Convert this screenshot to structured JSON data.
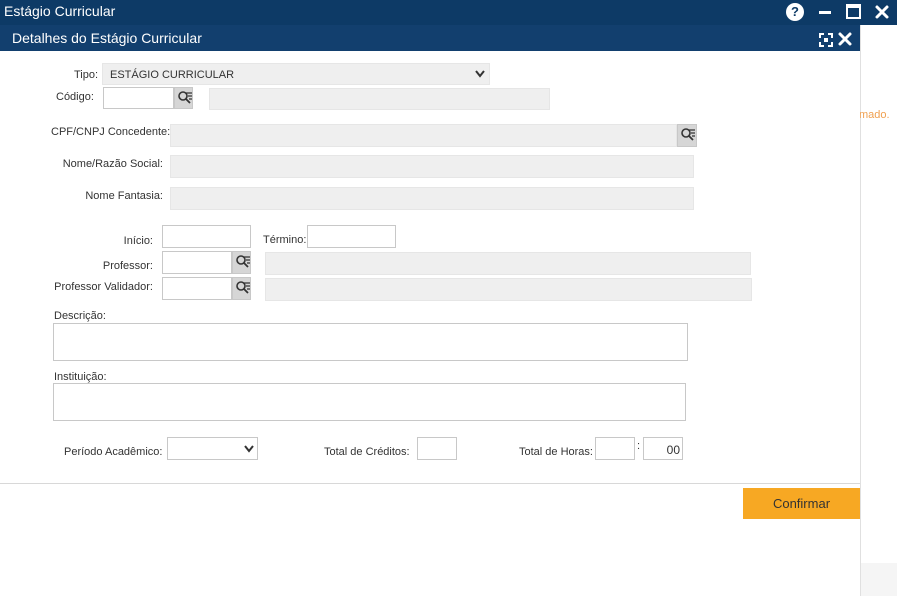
{
  "window": {
    "title": "Estágio Curricular"
  },
  "background": {
    "partial_text": "mado."
  },
  "dialog": {
    "title": "Detalhes do Estágio Curricular",
    "confirm_label": "Confirmar"
  },
  "form": {
    "tipo": {
      "label": "Tipo:",
      "value": "ESTÁGIO CURRICULAR"
    },
    "codigo": {
      "label": "Código:",
      "value": ""
    },
    "cpf_cnpj": {
      "label": "CPF/CNPJ Concedente:",
      "value": ""
    },
    "nome_razao": {
      "label": "Nome/Razão Social:",
      "value": ""
    },
    "nome_fantasia": {
      "label": "Nome Fantasia:",
      "value": ""
    },
    "inicio": {
      "label": "Início:",
      "value": ""
    },
    "termino": {
      "label": "Término:",
      "value": ""
    },
    "professor": {
      "label": "Professor:",
      "value": ""
    },
    "professor_validador": {
      "label": "Professor Validador:",
      "value": ""
    },
    "descricao": {
      "label": "Descrição:",
      "value": ""
    },
    "instituicao": {
      "label": "Instituição:",
      "value": ""
    },
    "periodo": {
      "label": "Período Acadêmico:",
      "value": ""
    },
    "total_creditos": {
      "label": "Total de Créditos:",
      "value": ""
    },
    "total_horas": {
      "label": "Total de Horas:",
      "hours": "",
      "separator": ":",
      "minutes": "00"
    }
  },
  "icons": {
    "help": "help-icon",
    "minimize": "minimize-icon",
    "maximize": "maximize-icon",
    "close": "close-icon",
    "expand": "expand-icon",
    "lookup": "search-list-icon",
    "calendar": "calendar-icon"
  },
  "colors": {
    "titlebar": "#0d3a66",
    "dialog_header": "#123f6e",
    "confirm": "#f7a823",
    "calendar_icon": "#e07020"
  }
}
